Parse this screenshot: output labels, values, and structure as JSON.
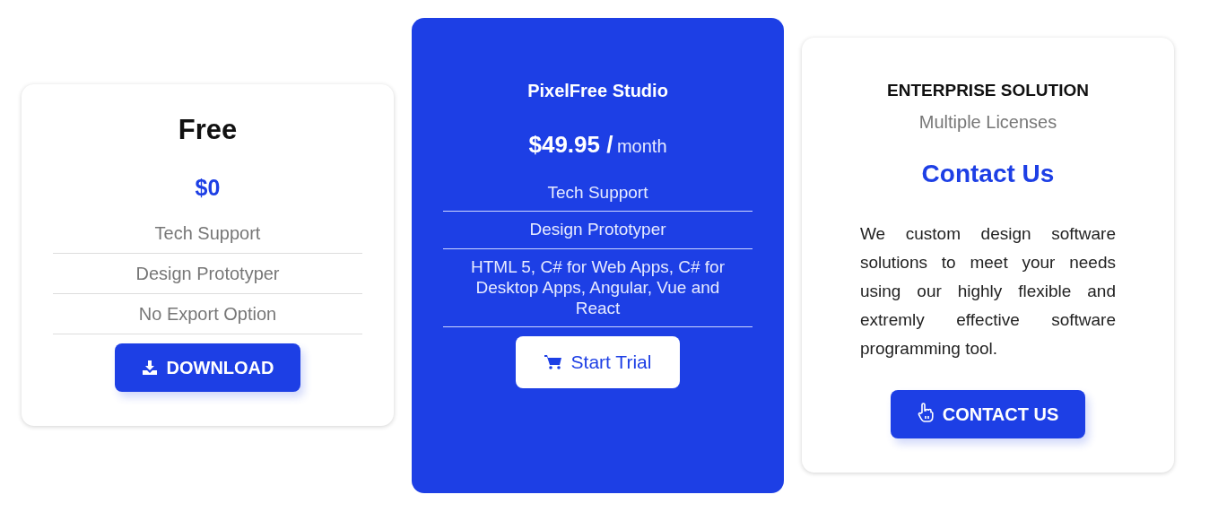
{
  "plans": [
    {
      "kind": "basic",
      "highlighted": false,
      "title": "Free",
      "price": "$0",
      "features": [
        "Tech Support",
        "Design Prototyper",
        "No Export Option"
      ],
      "button": {
        "label": "DOWNLOAD"
      }
    },
    {
      "kind": "featured",
      "highlighted": true,
      "title": "PixelFree Studio",
      "price": "$49.95 /",
      "price_unit": "month",
      "features": [
        "Tech Support",
        "Design Prototyper",
        "HTML 5, C# for Web Apps, C# for Desktop Apps, Angular, Vue and React"
      ],
      "button": {
        "label": "Start Trial"
      }
    },
    {
      "kind": "contact",
      "highlighted": false,
      "title": "ENTERPRISE SOLUTION",
      "subtitle": "Multiple Licenses",
      "price": "Contact Us",
      "description": "We custom design software solutions to meet your needs using our highly flexible and extremly effective software programming tool.",
      "button": {
        "label": "CONTACT US"
      }
    }
  ]
}
